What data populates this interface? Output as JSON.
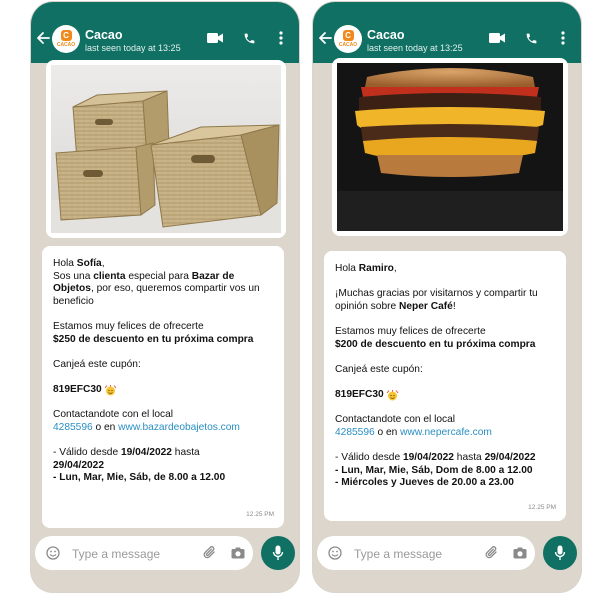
{
  "chats": [
    {
      "id": "left",
      "contact_name": "Cacao",
      "last_seen": "last seen today at 13:25",
      "logo_letter": "C",
      "logo_word": "CACAO",
      "image_subject": "woven-baskets",
      "greeting_prefix": "Hola ",
      "customer_name": "Sofía",
      "greeting_suffix": ",",
      "intro_line_a": "Sos una ",
      "intro_bold_a": "clienta",
      "intro_line_b": " especial para ",
      "intro_bold_b": "Bazar de Objetos",
      "intro_line_c": ", por eso, queremos compartir vos un beneficio",
      "offer_line": "Estamos muy felices de ofrecerte",
      "offer_bold": "$250 de descuento en tu próxima compra",
      "redeem_line": "Canjeá este cupón:",
      "coupon_code": "819EFC30",
      "contact_line": "Contactandote con el local",
      "phone_number": "4285596",
      "or_text": " o en ",
      "website": "www.bazardeobajetos.com",
      "valid_prefix": "- Válido desde ",
      "valid_from": "19/04/2022",
      "valid_mid": " hasta",
      "valid_to": "29/04/2022",
      "schedule_1": "- Lun, Mar, Mie, Sáb, de 8.00 a 12.00",
      "schedule_2": "",
      "timestamp": "12.25 PM",
      "input_placeholder": "Type a message"
    },
    {
      "id": "right",
      "contact_name": "Cacao",
      "last_seen": "last seen today at 13:25",
      "logo_letter": "C",
      "logo_word": "CACAO",
      "image_subject": "burger",
      "greeting_prefix": "Hola ",
      "customer_name": "Ramiro",
      "greeting_suffix": ",",
      "thanks_line": "¡Muchas gracias por visitarnos y compartir tu opinión sobre ",
      "thanks_bold": "Neper Café",
      "thanks_end": "!",
      "offer_line": "Estamos muy felices de ofrecerte",
      "offer_bold": "$200 de descuento en tu próxima compra",
      "redeem_line": "Canjeá este cupón:",
      "coupon_code": "819EFC30",
      "contact_line": "Contactandote con el local",
      "phone_number": "4285596",
      "or_text": " o en ",
      "website": "www.nepercafe.com",
      "valid_prefix": "- Válido desde ",
      "valid_from": "19/04/2022",
      "valid_mid": " hasta ",
      "valid_to": "29/04/2022",
      "schedule_1": "- Lun, Mar, Mie, Sáb, Dom de 8.00 a 12.00",
      "schedule_2": "- Miércoles y Jueves de 20.00 a 23.00",
      "timestamp": "12.25 PM",
      "input_placeholder": "Type a message"
    }
  ],
  "colors": {
    "header_green": "#0f7063",
    "chat_background": "#dcd6cc",
    "link_blue": "#2a8fc4",
    "brand_orange": "#f08a1c"
  },
  "icons": [
    "back-arrow-icon",
    "video-call-icon",
    "voice-call-icon",
    "more-menu-icon",
    "emoji-icon",
    "attach-icon",
    "camera-icon",
    "mic-icon",
    "party-emoji-icon"
  ]
}
